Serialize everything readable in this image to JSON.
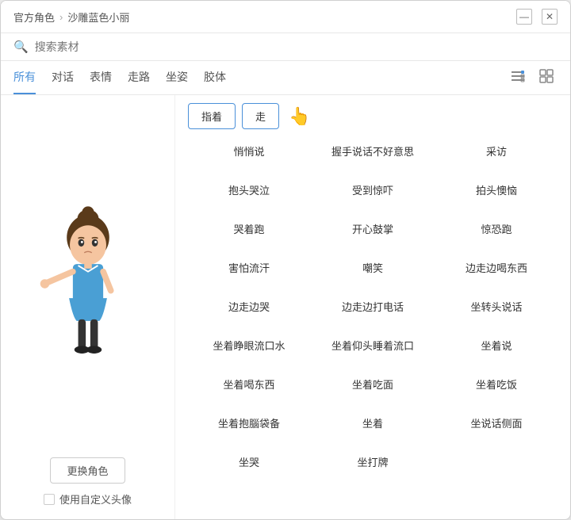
{
  "window": {
    "title": "官方角色",
    "breadcrumb": [
      "官方角色",
      "沙雕蓝色小丽"
    ],
    "breadcrumb_sep": "›"
  },
  "titlebar": {
    "minimize_label": "—",
    "close_label": "✕"
  },
  "search": {
    "placeholder": "搜索素材"
  },
  "tabs": [
    {
      "id": "all",
      "label": "所有",
      "active": true
    },
    {
      "id": "dialog",
      "label": "对话",
      "active": false
    },
    {
      "id": "expression",
      "label": "表情",
      "active": false
    },
    {
      "id": "walk",
      "label": "走路",
      "active": false
    },
    {
      "id": "posture",
      "label": "坐姿",
      "active": false
    },
    {
      "id": "body",
      "label": "胶体",
      "active": false
    }
  ],
  "view_toggles": {
    "list_icon": "☰",
    "grid_icon": "⊞"
  },
  "left_panel": {
    "change_char_label": "更换角色",
    "custom_avatar_label": "使用自定义头像"
  },
  "filter_chips": [
    {
      "label": "指着",
      "active": true
    },
    {
      "label": "走",
      "active": false
    }
  ],
  "actions": [
    "悄悄说",
    "握手说话不好意思",
    "采访",
    "抱头哭泣",
    "受到惊吓",
    "拍头懊恼",
    "哭着跑",
    "开心鼓掌",
    "惊恐跑",
    "害怕流汗",
    "嘲笑",
    "边走边喝东西",
    "边走边哭",
    "边走边打电话",
    "坐转头说话",
    "坐着睁眼流口水",
    "坐着仰头睡着流口",
    "坐着说",
    "坐着喝东西",
    "坐着吃面",
    "坐着吃饭",
    "坐着抱腦袋备",
    "坐着",
    "坐说话侧面",
    "坐哭",
    "坐打牌"
  ]
}
